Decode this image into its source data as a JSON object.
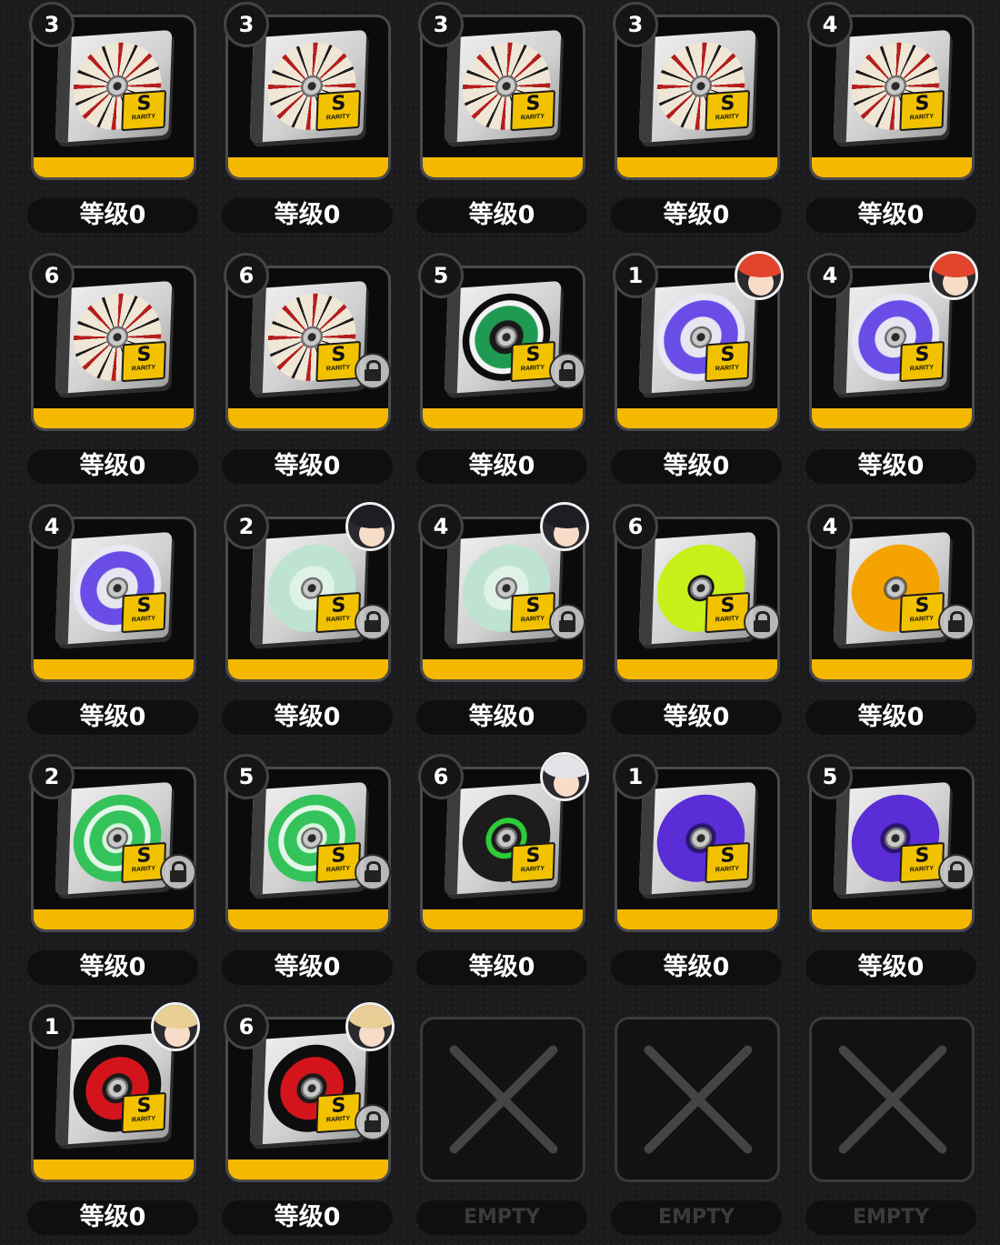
{
  "discs": [
    {
      "badge": "3",
      "level": "等级0",
      "design": "star-compass",
      "locked": false,
      "avatar": null
    },
    {
      "badge": "3",
      "level": "等级0",
      "design": "star-compass",
      "locked": false,
      "avatar": null
    },
    {
      "badge": "3",
      "level": "等级0",
      "design": "star-compass",
      "locked": false,
      "avatar": null
    },
    {
      "badge": "3",
      "level": "等级0",
      "design": "star-compass",
      "locked": false,
      "avatar": null
    },
    {
      "badge": "4",
      "level": "等级0",
      "design": "star-compass",
      "locked": false,
      "avatar": null
    },
    {
      "badge": "6",
      "level": "等级0",
      "design": "star-compass",
      "locked": false,
      "avatar": null
    },
    {
      "badge": "6",
      "level": "等级0",
      "design": "star-compass",
      "locked": true,
      "avatar": null
    },
    {
      "badge": "5",
      "level": "等级0",
      "design": "oko-green",
      "locked": true,
      "avatar": null
    },
    {
      "badge": "1",
      "level": "等级0",
      "design": "purple-stars",
      "locked": false,
      "avatar": "red-hair"
    },
    {
      "badge": "4",
      "level": "等级0",
      "design": "purple-stars",
      "locked": false,
      "avatar": "red-hair"
    },
    {
      "badge": "4",
      "level": "等级0",
      "design": "purple-stars",
      "locked": false,
      "avatar": null
    },
    {
      "badge": "2",
      "level": "等级0",
      "design": "freedom-mint",
      "locked": true,
      "avatar": "black-hair"
    },
    {
      "badge": "4",
      "level": "等级0",
      "design": "freedom-mint",
      "locked": true,
      "avatar": "black-hair"
    },
    {
      "badge": "6",
      "level": "等级0",
      "design": "lime-two",
      "locked": true,
      "avatar": null
    },
    {
      "badge": "4",
      "level": "等级0",
      "design": "orange-grafitti",
      "locked": true,
      "avatar": null
    },
    {
      "badge": "2",
      "level": "等级0",
      "design": "green-grafitti",
      "locked": true,
      "avatar": null
    },
    {
      "badge": "5",
      "level": "等级0",
      "design": "green-grafitti",
      "locked": true,
      "avatar": null
    },
    {
      "badge": "6",
      "level": "等级0",
      "design": "dark-green-tri",
      "locked": false,
      "avatar": "white-hair"
    },
    {
      "badge": "1",
      "level": "等级0",
      "design": "purple-swirl",
      "locked": false,
      "avatar": null
    },
    {
      "badge": "5",
      "level": "等级0",
      "design": "purple-swirl",
      "locked": true,
      "avatar": null
    },
    {
      "badge": "1",
      "level": "等级0",
      "design": "red-swirl",
      "locked": false,
      "avatar": "blonde-hair"
    },
    {
      "badge": "6",
      "level": "等级0",
      "design": "red-swirl",
      "locked": true,
      "avatar": "blonde-hair"
    }
  ],
  "rarity_letter": "S",
  "rarity_label": "RARITY",
  "empty_slots": [
    {
      "label": "EMPTY"
    },
    {
      "label": "EMPTY"
    },
    {
      "label": "EMPTY"
    }
  ],
  "colors": {
    "accent_yellow": "#f5b800",
    "star-compass": "#efe6d5",
    "oko-green": "#1f9a52",
    "purple-stars": "#6a4de6",
    "freedom-mint": "#bfe3d1",
    "lime-two": "#c8f01a",
    "orange-grafitti": "#f5a300",
    "green-grafitti": "#34c25a",
    "dark-green-tri": "#1c1c1c",
    "purple-swirl": "#5a2dd6",
    "red-swirl": "#d4141b"
  }
}
